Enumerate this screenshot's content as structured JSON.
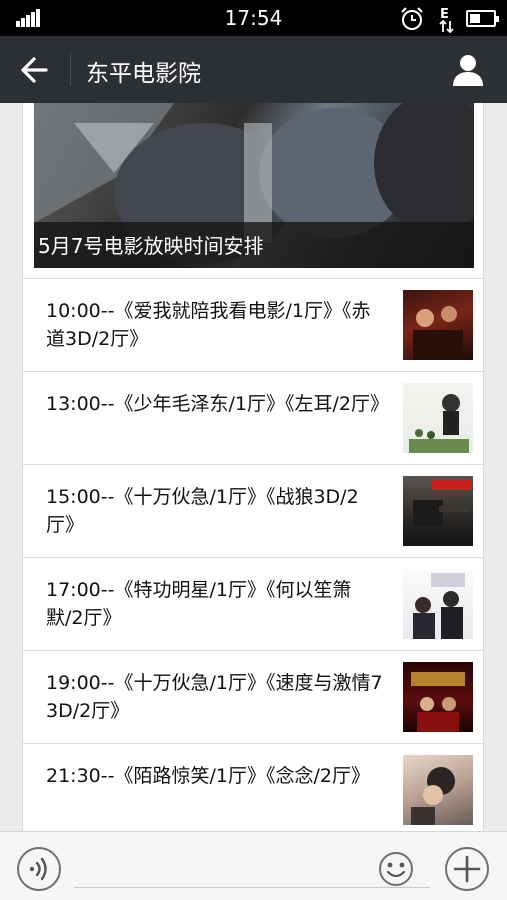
{
  "status_bar": {
    "time": "17:54",
    "icons": [
      "signal-icon",
      "alarm-clock-icon",
      "data-indicator-icon",
      "battery-icon"
    ]
  },
  "header": {
    "title": "东平电影院",
    "back_icon": "arrow-left-icon",
    "profile_icon": "user-icon"
  },
  "article": {
    "cover_title": "5月7号电影放映时间安排",
    "items": [
      {
        "text": "10:00--《爱我就陪我看电影/1厅》《赤道3D/2厅》"
      },
      {
        "text": "13:00--《少年毛泽东/1厅》《左耳/2厅》"
      },
      {
        "text": "15:00--《十万伙急/1厅》《战狼3D/2厅》"
      },
      {
        "text": "17:00--《特功明星/1厅》《何以笙箫默/2厅》"
      },
      {
        "text": "19:00--《十万伙急/1厅》《速度与激情7 3D/2厅》"
      },
      {
        "text": "21:30--《陌路惊笑/1厅》《念念/2厅》"
      }
    ]
  },
  "input_bar": {
    "value": "",
    "placeholder": "",
    "icons": [
      "voice-icon",
      "emoji-icon",
      "plus-icon"
    ]
  },
  "colors": {
    "status_bar": "#000000",
    "title_bar": "#2c2f33",
    "page_background": "#ebebeb",
    "card": "#ffffff"
  }
}
